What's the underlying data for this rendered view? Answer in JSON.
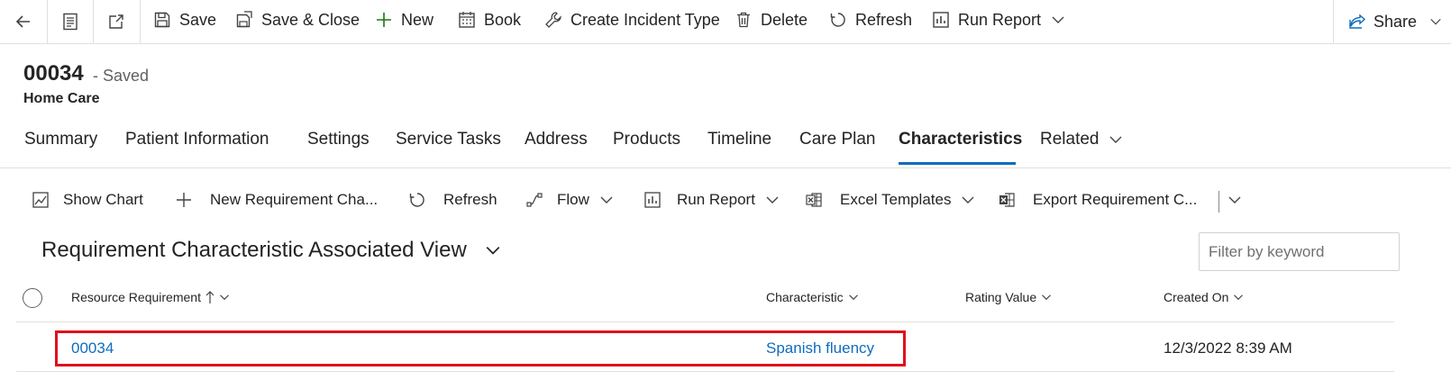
{
  "cmdbar": {
    "save": "Save",
    "save_close": "Save & Close",
    "new": "New",
    "book": "Book",
    "create_incident_type": "Create Incident Type",
    "delete": "Delete",
    "refresh": "Refresh",
    "run_report": "Run Report",
    "share": "Share"
  },
  "header": {
    "title": "00034",
    "status": "- Saved",
    "entity": "Home Care"
  },
  "tabs": [
    {
      "label": "Summary"
    },
    {
      "label": "Patient Information"
    },
    {
      "label": "Settings"
    },
    {
      "label": "Service Tasks"
    },
    {
      "label": "Address"
    },
    {
      "label": "Products"
    },
    {
      "label": "Timeline"
    },
    {
      "label": "Care Plan"
    },
    {
      "label": "Characteristics",
      "active": true
    },
    {
      "label": "Related"
    }
  ],
  "grid": {
    "commands": {
      "show_chart": "Show Chart",
      "new_requirement": "New Requirement Cha...",
      "refresh": "Refresh",
      "flow": "Flow",
      "run_report": "Run Report",
      "excel_templates": "Excel Templates",
      "export": "Export Requirement C..."
    },
    "view_title": "Requirement Characteristic Associated View",
    "filter_placeholder": "Filter by keyword",
    "columns": {
      "resource_requirement": "Resource Requirement",
      "characteristic": "Characteristic",
      "rating_value": "Rating Value",
      "created_on": "Created On"
    },
    "rows": [
      {
        "resource_requirement": "00034",
        "characteristic": "Spanish fluency",
        "rating_value": "",
        "created_on": "12/3/2022 8:39 AM"
      }
    ]
  },
  "colors": {
    "accent": "#0f6cbd",
    "highlight": "#e0101a",
    "add_icon": "#107c10"
  }
}
